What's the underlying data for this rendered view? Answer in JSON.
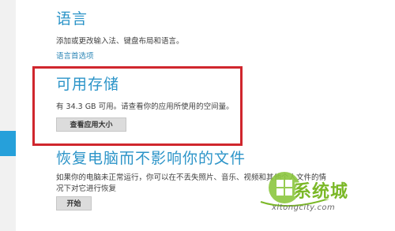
{
  "language": {
    "title": "语言",
    "description": "添加或更改输入法、键盘布局和语言。",
    "link": "语言首选项"
  },
  "storage": {
    "title": "可用存储",
    "description": "有 34.3 GB 可用。请查看你的应用所使用的空间量。",
    "button": "查看应用大小"
  },
  "refresh": {
    "title": "恢复电脑而不影响你的文件",
    "description_line1": "如果你的电脑未正常运行，你可以在不丢失照片、音乐、视频和其他个人文件的情",
    "description_line2": "况下对它进行恢复",
    "button": "开始"
  },
  "watermark": {
    "brand": "系统城",
    "url": "xitongcity.com"
  },
  "colors": {
    "accent": "#2c94c8",
    "highlight": "#d0262d",
    "brand_green": "#7bb827"
  }
}
